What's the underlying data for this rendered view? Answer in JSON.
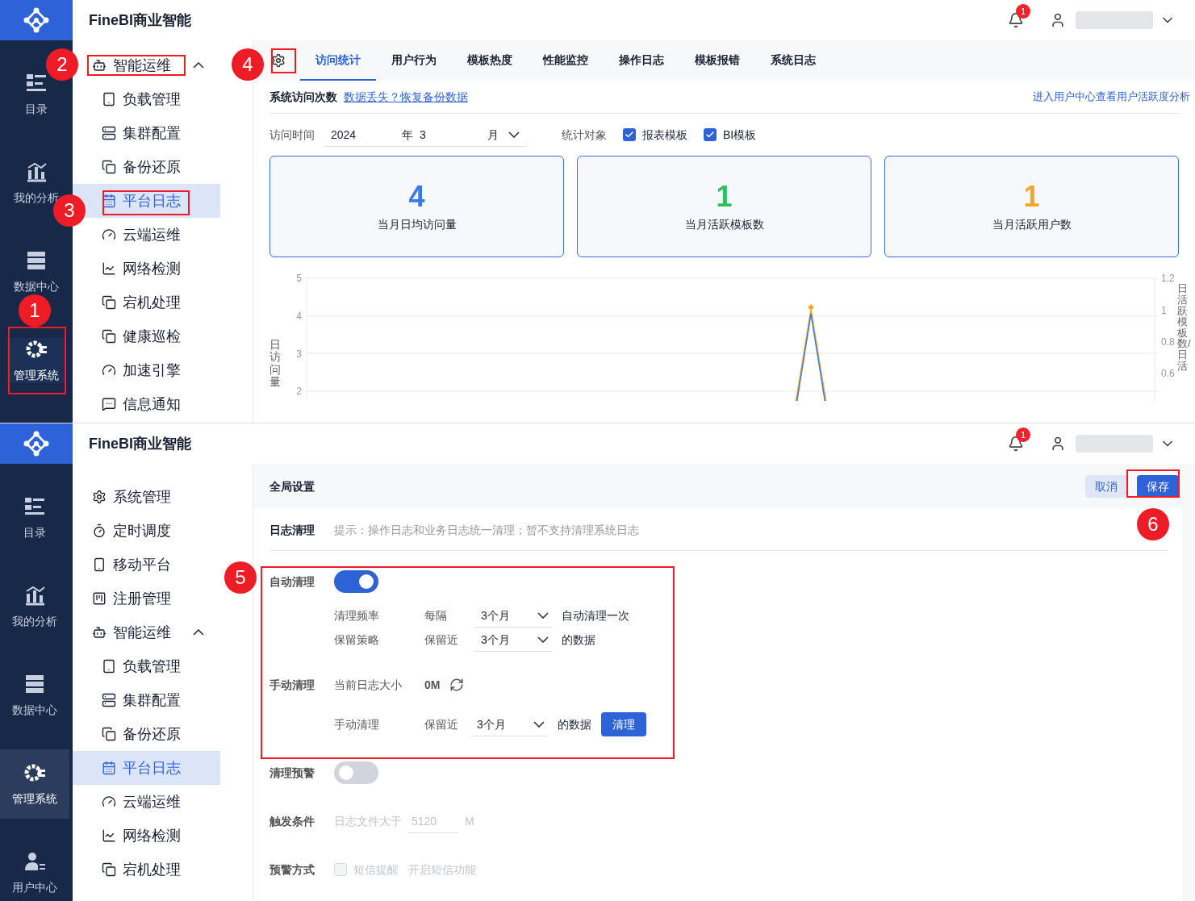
{
  "top": {
    "header": {
      "title": "FineBI商业智能",
      "badge": "1"
    },
    "rail": [
      {
        "label": "目录",
        "selected": false
      },
      {
        "label": "我的分析",
        "selected": false
      },
      {
        "label": "数据中心",
        "selected": false
      },
      {
        "label": "管理系统",
        "selected": true
      }
    ],
    "sidebar": [
      {
        "label": "智能运维",
        "kind": "ops",
        "expanded": true,
        "selected": false,
        "highlighted": true,
        "children": [
          {
            "label": "负载管理",
            "kind": "tablet",
            "selected": false
          },
          {
            "label": "集群配置",
            "kind": "server",
            "selected": false
          },
          {
            "label": "备份还原",
            "kind": "copy",
            "selected": false
          },
          {
            "label": "平台日志",
            "kind": "calendar",
            "selected": true
          },
          {
            "label": "云端运维",
            "kind": "gauge",
            "selected": false
          },
          {
            "label": "网络检测",
            "kind": "chart",
            "selected": false
          },
          {
            "label": "宕机处理",
            "kind": "copy",
            "selected": false
          },
          {
            "label": "健康巡检",
            "kind": "copy",
            "selected": false
          },
          {
            "label": "加速引擎",
            "kind": "gauge",
            "selected": false
          },
          {
            "label": "信息通知",
            "kind": "message",
            "selected": false
          }
        ]
      }
    ],
    "tabs": [
      {
        "label": "访问统计",
        "selected": true
      },
      {
        "label": "用户行为",
        "selected": false
      },
      {
        "label": "模板热度",
        "selected": false
      },
      {
        "label": "性能监控",
        "selected": false
      },
      {
        "label": "操作日志",
        "selected": false
      },
      {
        "label": "模板报错",
        "selected": false
      },
      {
        "label": "系统日志",
        "selected": false
      }
    ],
    "section_title": "系统访问次数",
    "restore_link": "数据丢失？恢复备份数据",
    "user_center_link": "进入用户中心查看用户活跃度分析",
    "filters": {
      "time_label": "访问时间",
      "year": "2024",
      "year_unit": "年",
      "month": "3",
      "month_unit": "月",
      "object_label": "统计对象",
      "checkboxes": [
        {
          "label": "报表模板",
          "checked": true
        },
        {
          "label": "BI模板",
          "checked": true
        }
      ]
    },
    "stats": [
      {
        "value": "4",
        "label": "当月日均访问量",
        "color": "#3a7bea"
      },
      {
        "value": "1",
        "label": "当月活跃模板数",
        "color": "#2fc05a"
      },
      {
        "value": "1",
        "label": "当月活跃用户数",
        "color": "#f5a623"
      }
    ],
    "chart": {
      "ylabel": "日访问量",
      "yticks": [
        "5",
        "4",
        "3",
        "2"
      ],
      "y2label": "日活跃模板数/日活",
      "y2ticks": [
        "1.2",
        "1",
        "0.8",
        "0.6"
      ]
    }
  },
  "bottom": {
    "header": {
      "title": "FineBI商业智能",
      "badge": "1"
    },
    "rail": [
      {
        "label": "目录",
        "selected": false
      },
      {
        "label": "我的分析",
        "selected": false
      },
      {
        "label": "数据中心",
        "selected": false
      },
      {
        "label": "管理系统",
        "selected": true
      },
      {
        "label": "用户中心",
        "selected": false
      }
    ],
    "sidebar": [
      {
        "label": "系统管理",
        "kind": "gear",
        "selected": false
      },
      {
        "label": "定时调度",
        "kind": "timer",
        "selected": false
      },
      {
        "label": "移动平台",
        "kind": "mobile",
        "selected": false
      },
      {
        "label": "注册管理",
        "kind": "register",
        "selected": false
      },
      {
        "label": "智能运维",
        "kind": "ops",
        "expanded": true,
        "selected": false,
        "highlighted": false,
        "children": [
          {
            "label": "负载管理",
            "kind": "tablet",
            "selected": false
          },
          {
            "label": "集群配置",
            "kind": "server",
            "selected": false
          },
          {
            "label": "备份还原",
            "kind": "copy",
            "selected": false
          },
          {
            "label": "平台日志",
            "kind": "calendar",
            "selected": true
          },
          {
            "label": "云端运维",
            "kind": "gauge",
            "selected": false
          },
          {
            "label": "网络检测",
            "kind": "chart",
            "selected": false
          },
          {
            "label": "宕机处理",
            "kind": "copy",
            "selected": false
          }
        ]
      }
    ],
    "title": "全局设置",
    "cancel": "取消",
    "save": "保存",
    "section": "日志清理",
    "hint": "提示：操作日志和业务日志统一清理；暂不支持清理系统日志",
    "auto": {
      "label": "自动清理",
      "on": true,
      "rows": [
        {
          "label": "清理频率",
          "prefix": "每隔",
          "value": "3个月",
          "suffix": "自动清理一次"
        },
        {
          "label": "保留策略",
          "prefix": "保留近",
          "value": "3个月",
          "suffix": "的数据"
        }
      ]
    },
    "manual": {
      "label": "手动清理",
      "size_label": "当前日志大小",
      "size": "0M",
      "row": {
        "label": "手动清理",
        "prefix": "保留近",
        "value": "3个月",
        "suffix": "的数据"
      },
      "button": "清理"
    },
    "warning": {
      "label": "清理预警",
      "on": false
    },
    "trigger": {
      "label": "触发条件",
      "text": "日志文件大于",
      "value": "5120",
      "unit": "M"
    },
    "method": {
      "label": "预警方式",
      "checkbox": {
        "label": "短信提醒",
        "checked": false
      },
      "note": "开启短信功能"
    }
  },
  "callouts": [
    "1",
    "2",
    "3",
    "4",
    "5",
    "6"
  ]
}
